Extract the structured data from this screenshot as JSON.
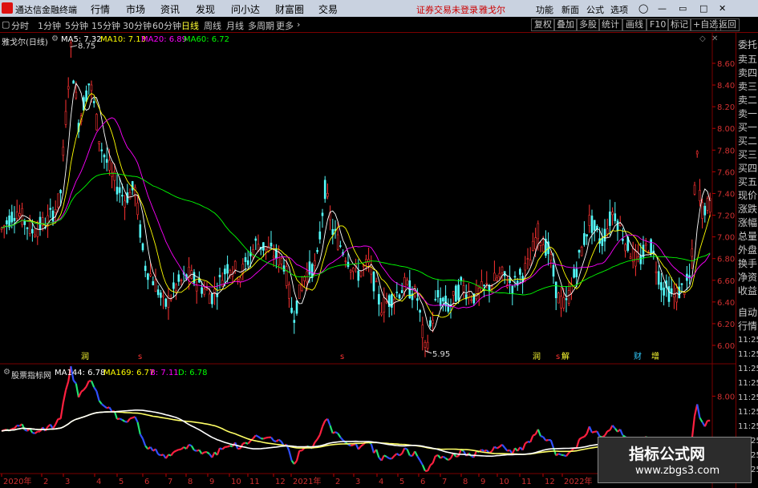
{
  "app": {
    "name": "通达信金融终端"
  },
  "menu": [
    "行情",
    "市场",
    "资讯",
    "发现",
    "问小达",
    "财富圈",
    "交易"
  ],
  "notice": [
    "证券交易未登录",
    "雅戈尔"
  ],
  "top_right": [
    "功能",
    "新面",
    "公式",
    "选项"
  ],
  "periods": [
    "分时",
    "1分钟",
    "5分钟",
    "15分钟",
    "30分钟",
    "60分钟",
    "日线",
    "周线",
    "月线",
    "多周期",
    "更多"
  ],
  "active_period": "日线",
  "right_buttons": [
    "复权",
    "叠加",
    "多股",
    "统计",
    "画线",
    "F10",
    "标记",
    "+自选",
    "返回"
  ],
  "main_panel": {
    "title": "雅戈尔(日线)",
    "indicators": [
      {
        "label": "MA5: 7.32",
        "color": "#ffffff"
      },
      {
        "label": "MA10: 7.13",
        "color": "#ffff00"
      },
      {
        "label": "MA20: 6.89",
        "color": "#ff00ff"
      },
      {
        "label": "MA60: 6.72",
        "color": "#00ff00"
      }
    ],
    "high_label": "8.75",
    "low_label": "5.95",
    "price_axis": [
      "8.60",
      "8.40",
      "8.20",
      "8.00",
      "7.80",
      "7.60",
      "7.40",
      "7.20",
      "7.00",
      "6.80",
      "6.60",
      "6.40",
      "6.20",
      "6.00"
    ],
    "event_markers": [
      {
        "text": "润",
        "color": "#ff3"
      },
      {
        "text": "s",
        "color": "#f33"
      },
      {
        "text": "s",
        "color": "#f33"
      },
      {
        "text": "润",
        "color": "#ff3"
      },
      {
        "text": "s",
        "color": "#f33"
      },
      {
        "text": "解",
        "color": "#ff3"
      },
      {
        "text": "财",
        "color": "#3cf"
      },
      {
        "text": "增",
        "color": "#ff3"
      }
    ]
  },
  "sub_panel": {
    "title": "股票指标网",
    "indicators": [
      {
        "label": "MA144: 6.78",
        "color": "#ffffff"
      },
      {
        "label": "MA169: 6.77",
        "color": "#ffff00"
      },
      {
        "label": "B: 7.11",
        "color": "#ff00ff"
      },
      {
        "label": "D: 6.78",
        "color": "#00ff00"
      }
    ],
    "price_axis": [
      "8.00"
    ]
  },
  "time_axis": [
    "2020年",
    "2",
    "3",
    "4",
    "5",
    "6",
    "7",
    "8",
    "9",
    "10",
    "11",
    "12",
    "2021年",
    "2",
    "3",
    "4",
    "5",
    "6",
    "7",
    "8",
    "9",
    "10",
    "11",
    "12",
    "2022年",
    "2",
    "3",
    "4",
    "5",
    "6",
    "7",
    "8",
    "9"
  ],
  "right_panel": [
    "委托",
    "卖五",
    "卖四",
    "卖三",
    "卖二",
    "卖一",
    "买一",
    "买二",
    "买三",
    "买四",
    "买五",
    "现价",
    "涨跌",
    "涨幅",
    "总量",
    "外盘",
    "换手",
    "净资",
    "收益",
    "自动",
    "行情",
    "11:25",
    "11:25",
    "11:25",
    "11:25",
    "11:25",
    "11:25",
    "11:25",
    "11:25",
    "11:25",
    "11:25"
  ],
  "watermark": {
    "title": "指标公式网",
    "url": "www.zbgs3.com"
  },
  "colors": {
    "up": "#ff3232",
    "down": "#54fcfc",
    "ma5": "#ffffff",
    "ma10": "#ffff00",
    "ma20": "#ff00ff",
    "ma60": "#00ff00"
  }
}
